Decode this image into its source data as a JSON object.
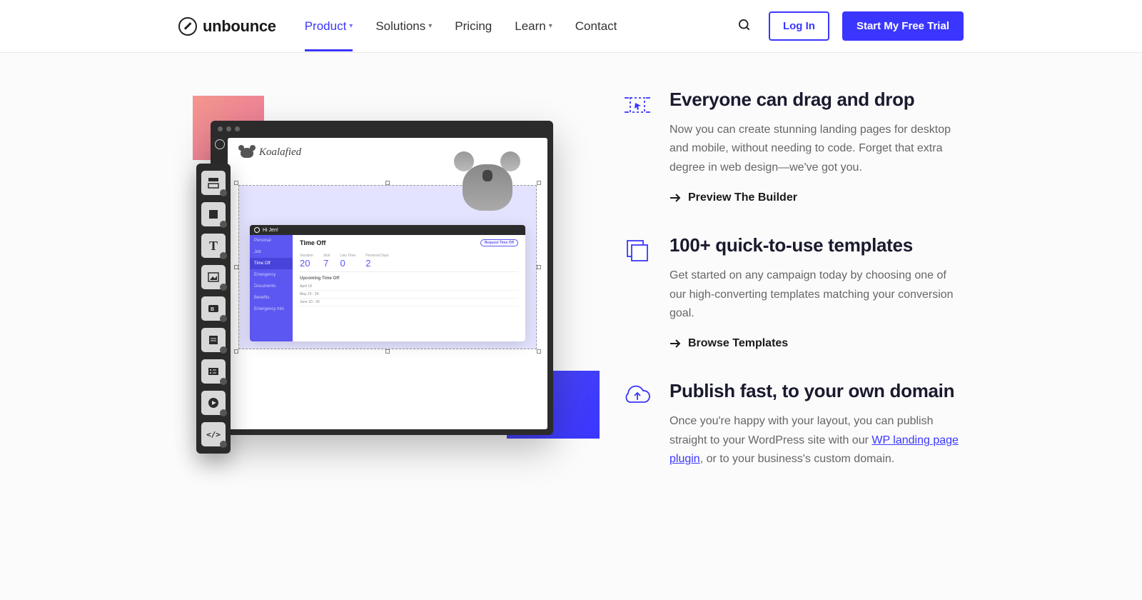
{
  "brand": "unbounce",
  "nav": {
    "items": [
      {
        "label": "Product",
        "dropdown": true,
        "active": true
      },
      {
        "label": "Solutions",
        "dropdown": true,
        "active": false
      },
      {
        "label": "Pricing",
        "dropdown": false,
        "active": false
      },
      {
        "label": "Learn",
        "dropdown": true,
        "active": false
      },
      {
        "label": "Contact",
        "dropdown": false,
        "active": false
      }
    ]
  },
  "header": {
    "login": "Log In",
    "trial": "Start My Free Trial"
  },
  "builder": {
    "site_name": "Koalafied",
    "dashboard": {
      "greeting": "Hi Jen!",
      "title": "Time Off",
      "request_btn": "Request Time Off",
      "sidebar_items": [
        "Personal",
        "Job",
        "Time Off",
        "Emergency",
        "Documents",
        "Benefits",
        "Emergency Info"
      ],
      "active_sidebar": "Time Off",
      "stats": [
        {
          "label": "Vacation",
          "value": "20"
        },
        {
          "label": "Sick",
          "value": "7"
        },
        {
          "label": "Lieu Time",
          "value": "0"
        },
        {
          "label": "Personal Days",
          "value": "2"
        }
      ],
      "upcoming_title": "Upcoming Time Off",
      "upcoming": [
        "April 19",
        "May 23 - 24",
        "June 10 - 20"
      ]
    },
    "tools": [
      "layout",
      "image-area",
      "text",
      "image",
      "button",
      "paragraph",
      "list",
      "video",
      "code"
    ]
  },
  "features": {
    "f1": {
      "title": "Everyone can drag and drop",
      "desc": "Now you can create stunning landing pages for desktop and mobile, without needing to code. Forget that extra degree in web design—we've got you.",
      "cta": "Preview The Builder"
    },
    "f2": {
      "title": "100+ quick-to-use templates",
      "desc": "Get started on any campaign today by choosing one of our high-converting templates matching your conversion goal.",
      "cta": "Browse Templates"
    },
    "f3": {
      "title": "Publish fast, to your own domain",
      "desc_pre": "Once you're happy with your layout, you can publish straight to your WordPress site with our ",
      "desc_link": "WP landing page plugin",
      "desc_post": ", or to your business's custom domain."
    }
  }
}
